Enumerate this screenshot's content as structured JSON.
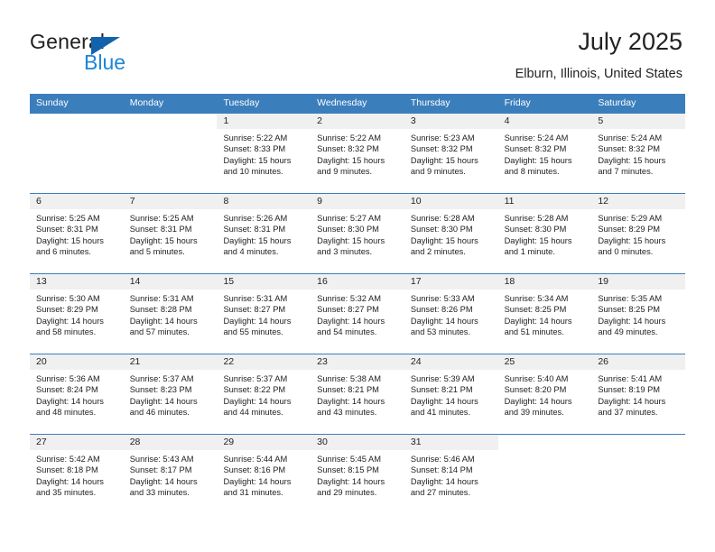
{
  "brand": {
    "name_part1": "General",
    "name_part2": "Blue",
    "flag_color": "#1263ab",
    "blue_color": "#1a86d8"
  },
  "header": {
    "title": "July 2025",
    "location": "Elburn, Illinois, United States"
  },
  "theme": {
    "header_blue": "#3b7ebc",
    "day_head_gray": "#f0f0f0",
    "text": "#222222"
  },
  "weekdays": [
    "Sunday",
    "Monday",
    "Tuesday",
    "Wednesday",
    "Thursday",
    "Friday",
    "Saturday"
  ],
  "weeks": [
    [
      {
        "day": "",
        "blank": true,
        "sunrise": "",
        "sunset": "",
        "daylight1": "",
        "daylight2": ""
      },
      {
        "day": "",
        "blank": true,
        "sunrise": "",
        "sunset": "",
        "daylight1": "",
        "daylight2": ""
      },
      {
        "day": "1",
        "sunrise": "Sunrise: 5:22 AM",
        "sunset": "Sunset: 8:33 PM",
        "daylight1": "Daylight: 15 hours",
        "daylight2": "and 10 minutes."
      },
      {
        "day": "2",
        "sunrise": "Sunrise: 5:22 AM",
        "sunset": "Sunset: 8:32 PM",
        "daylight1": "Daylight: 15 hours",
        "daylight2": "and 9 minutes."
      },
      {
        "day": "3",
        "sunrise": "Sunrise: 5:23 AM",
        "sunset": "Sunset: 8:32 PM",
        "daylight1": "Daylight: 15 hours",
        "daylight2": "and 9 minutes."
      },
      {
        "day": "4",
        "sunrise": "Sunrise: 5:24 AM",
        "sunset": "Sunset: 8:32 PM",
        "daylight1": "Daylight: 15 hours",
        "daylight2": "and 8 minutes."
      },
      {
        "day": "5",
        "sunrise": "Sunrise: 5:24 AM",
        "sunset": "Sunset: 8:32 PM",
        "daylight1": "Daylight: 15 hours",
        "daylight2": "and 7 minutes."
      }
    ],
    [
      {
        "day": "6",
        "sunrise": "Sunrise: 5:25 AM",
        "sunset": "Sunset: 8:31 PM",
        "daylight1": "Daylight: 15 hours",
        "daylight2": "and 6 minutes."
      },
      {
        "day": "7",
        "sunrise": "Sunrise: 5:25 AM",
        "sunset": "Sunset: 8:31 PM",
        "daylight1": "Daylight: 15 hours",
        "daylight2": "and 5 minutes."
      },
      {
        "day": "8",
        "sunrise": "Sunrise: 5:26 AM",
        "sunset": "Sunset: 8:31 PM",
        "daylight1": "Daylight: 15 hours",
        "daylight2": "and 4 minutes."
      },
      {
        "day": "9",
        "sunrise": "Sunrise: 5:27 AM",
        "sunset": "Sunset: 8:30 PM",
        "daylight1": "Daylight: 15 hours",
        "daylight2": "and 3 minutes."
      },
      {
        "day": "10",
        "sunrise": "Sunrise: 5:28 AM",
        "sunset": "Sunset: 8:30 PM",
        "daylight1": "Daylight: 15 hours",
        "daylight2": "and 2 minutes."
      },
      {
        "day": "11",
        "sunrise": "Sunrise: 5:28 AM",
        "sunset": "Sunset: 8:30 PM",
        "daylight1": "Daylight: 15 hours",
        "daylight2": "and 1 minute."
      },
      {
        "day": "12",
        "sunrise": "Sunrise: 5:29 AM",
        "sunset": "Sunset: 8:29 PM",
        "daylight1": "Daylight: 15 hours",
        "daylight2": "and 0 minutes."
      }
    ],
    [
      {
        "day": "13",
        "sunrise": "Sunrise: 5:30 AM",
        "sunset": "Sunset: 8:29 PM",
        "daylight1": "Daylight: 14 hours",
        "daylight2": "and 58 minutes."
      },
      {
        "day": "14",
        "sunrise": "Sunrise: 5:31 AM",
        "sunset": "Sunset: 8:28 PM",
        "daylight1": "Daylight: 14 hours",
        "daylight2": "and 57 minutes."
      },
      {
        "day": "15",
        "sunrise": "Sunrise: 5:31 AM",
        "sunset": "Sunset: 8:27 PM",
        "daylight1": "Daylight: 14 hours",
        "daylight2": "and 55 minutes."
      },
      {
        "day": "16",
        "sunrise": "Sunrise: 5:32 AM",
        "sunset": "Sunset: 8:27 PM",
        "daylight1": "Daylight: 14 hours",
        "daylight2": "and 54 minutes."
      },
      {
        "day": "17",
        "sunrise": "Sunrise: 5:33 AM",
        "sunset": "Sunset: 8:26 PM",
        "daylight1": "Daylight: 14 hours",
        "daylight2": "and 53 minutes."
      },
      {
        "day": "18",
        "sunrise": "Sunrise: 5:34 AM",
        "sunset": "Sunset: 8:25 PM",
        "daylight1": "Daylight: 14 hours",
        "daylight2": "and 51 minutes."
      },
      {
        "day": "19",
        "sunrise": "Sunrise: 5:35 AM",
        "sunset": "Sunset: 8:25 PM",
        "daylight1": "Daylight: 14 hours",
        "daylight2": "and 49 minutes."
      }
    ],
    [
      {
        "day": "20",
        "sunrise": "Sunrise: 5:36 AM",
        "sunset": "Sunset: 8:24 PM",
        "daylight1": "Daylight: 14 hours",
        "daylight2": "and 48 minutes."
      },
      {
        "day": "21",
        "sunrise": "Sunrise: 5:37 AM",
        "sunset": "Sunset: 8:23 PM",
        "daylight1": "Daylight: 14 hours",
        "daylight2": "and 46 minutes."
      },
      {
        "day": "22",
        "sunrise": "Sunrise: 5:37 AM",
        "sunset": "Sunset: 8:22 PM",
        "daylight1": "Daylight: 14 hours",
        "daylight2": "and 44 minutes."
      },
      {
        "day": "23",
        "sunrise": "Sunrise: 5:38 AM",
        "sunset": "Sunset: 8:21 PM",
        "daylight1": "Daylight: 14 hours",
        "daylight2": "and 43 minutes."
      },
      {
        "day": "24",
        "sunrise": "Sunrise: 5:39 AM",
        "sunset": "Sunset: 8:21 PM",
        "daylight1": "Daylight: 14 hours",
        "daylight2": "and 41 minutes."
      },
      {
        "day": "25",
        "sunrise": "Sunrise: 5:40 AM",
        "sunset": "Sunset: 8:20 PM",
        "daylight1": "Daylight: 14 hours",
        "daylight2": "and 39 minutes."
      },
      {
        "day": "26",
        "sunrise": "Sunrise: 5:41 AM",
        "sunset": "Sunset: 8:19 PM",
        "daylight1": "Daylight: 14 hours",
        "daylight2": "and 37 minutes."
      }
    ],
    [
      {
        "day": "27",
        "sunrise": "Sunrise: 5:42 AM",
        "sunset": "Sunset: 8:18 PM",
        "daylight1": "Daylight: 14 hours",
        "daylight2": "and 35 minutes."
      },
      {
        "day": "28",
        "sunrise": "Sunrise: 5:43 AM",
        "sunset": "Sunset: 8:17 PM",
        "daylight1": "Daylight: 14 hours",
        "daylight2": "and 33 minutes."
      },
      {
        "day": "29",
        "sunrise": "Sunrise: 5:44 AM",
        "sunset": "Sunset: 8:16 PM",
        "daylight1": "Daylight: 14 hours",
        "daylight2": "and 31 minutes."
      },
      {
        "day": "30",
        "sunrise": "Sunrise: 5:45 AM",
        "sunset": "Sunset: 8:15 PM",
        "daylight1": "Daylight: 14 hours",
        "daylight2": "and 29 minutes."
      },
      {
        "day": "31",
        "sunrise": "Sunrise: 5:46 AM",
        "sunset": "Sunset: 8:14 PM",
        "daylight1": "Daylight: 14 hours",
        "daylight2": "and 27 minutes."
      },
      {
        "day": "",
        "blank": true,
        "sunrise": "",
        "sunset": "",
        "daylight1": "",
        "daylight2": ""
      },
      {
        "day": "",
        "blank": true,
        "sunrise": "",
        "sunset": "",
        "daylight1": "",
        "daylight2": ""
      }
    ]
  ]
}
